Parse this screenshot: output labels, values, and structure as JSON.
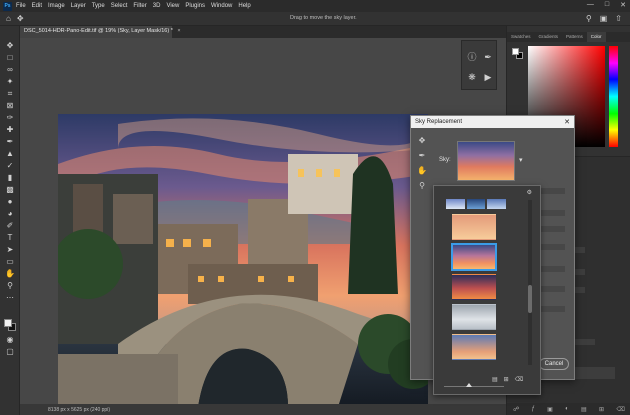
{
  "app": {
    "logo": "Ps",
    "menu": [
      "File",
      "Edit",
      "Image",
      "Layer",
      "Type",
      "Select",
      "Filter",
      "3D",
      "View",
      "Plugins",
      "Window",
      "Help"
    ],
    "window_controls": [
      "minimize-icon",
      "maximize-icon",
      "close-icon"
    ]
  },
  "options_bar": {
    "hint": "Drag to move the sky layer."
  },
  "document": {
    "tab_title": "DSC_5014-HDR-Pano-Edit.tif @ 19% (Sky, Layer Mask/16) *",
    "tab_close": "×",
    "status": "8138 px x 5625 px (240 ppi)"
  },
  "panels": {
    "tabs": [
      "Swatches",
      "Gradients",
      "Patterns",
      "Color"
    ],
    "active_tab": "Color"
  },
  "dialog": {
    "title": "Sky Replacement",
    "close": "✕",
    "sky_label": "Sky:",
    "cancel_label": "Cancel"
  },
  "colors": {
    "accent": "#3b9ce8",
    "ui_dark": "#323232",
    "canvas_bg": "#474747"
  }
}
